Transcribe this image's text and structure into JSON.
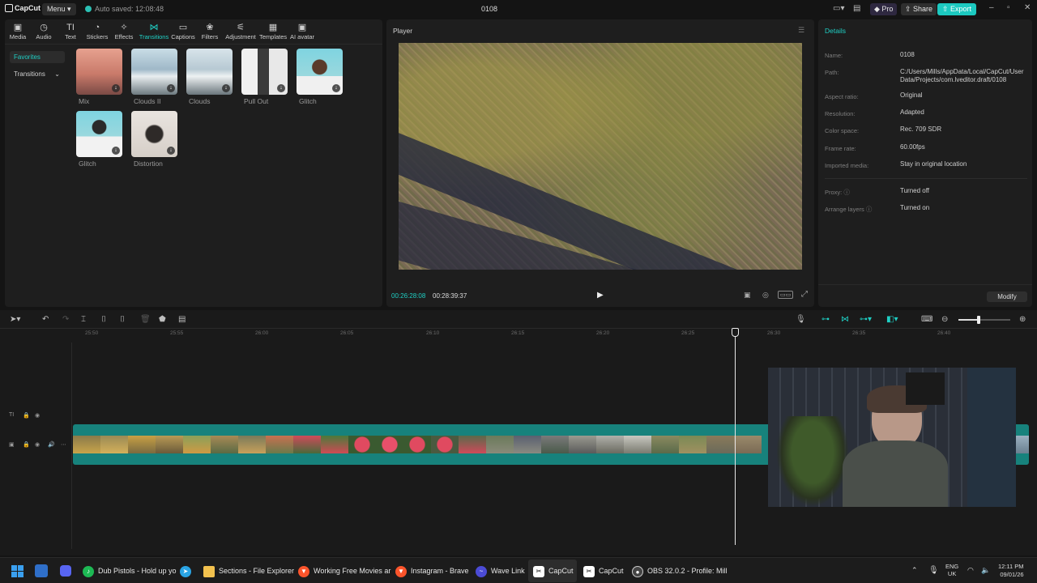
{
  "titlebar": {
    "logo": "CapCut",
    "menu_label": "Menu",
    "autosave": "Auto saved: 12:08:48",
    "doc_title": "0108",
    "pro_label": "Pro",
    "share_label": "Share",
    "export_label": "Export"
  },
  "tabs": [
    {
      "label": "Media",
      "icon": "media-icon"
    },
    {
      "label": "Audio",
      "icon": "audio-icon"
    },
    {
      "label": "Text",
      "icon": "text-icon"
    },
    {
      "label": "Stickers",
      "icon": "stickers-icon"
    },
    {
      "label": "Effects",
      "icon": "effects-icon"
    },
    {
      "label": "Transitions",
      "icon": "transitions-icon",
      "active": true
    },
    {
      "label": "Captions",
      "icon": "captions-icon"
    },
    {
      "label": "Filters",
      "icon": "filters-icon"
    },
    {
      "label": "Adjustment",
      "icon": "adjustment-icon"
    },
    {
      "label": "Templates",
      "icon": "templates-icon"
    },
    {
      "label": "AI avatar",
      "icon": "ai-avatar-icon"
    }
  ],
  "sidebar": {
    "favorites": "Favorites",
    "transitions": "Transitions"
  },
  "transitions": [
    {
      "label": "Mix"
    },
    {
      "label": "Clouds II"
    },
    {
      "label": "Clouds"
    },
    {
      "label": "Pull Out"
    },
    {
      "label": "Glitch"
    },
    {
      "label": "Glitch"
    },
    {
      "label": "Distortion"
    }
  ],
  "player": {
    "title": "Player",
    "current_time": "00:26:28:08",
    "total_time": "00:28:39:37"
  },
  "details": {
    "title": "Details",
    "rows": [
      {
        "label": "Name:",
        "value": "0108"
      },
      {
        "label": "Path:",
        "value": "C:/Users/Mills/AppData/Local/CapCut/User Data/Projects/com.lveditor.draft/0108"
      },
      {
        "label": "Aspect ratio:",
        "value": "Original"
      },
      {
        "label": "Resolution:",
        "value": "Adapted"
      },
      {
        "label": "Color space:",
        "value": "Rec. 709 SDR"
      },
      {
        "label": "Frame rate:",
        "value": "60.00fps"
      },
      {
        "label": "Imported media:",
        "value": "Stay in original location"
      },
      {
        "label": "Proxy:",
        "value": "Turned off"
      },
      {
        "label": "Arrange layers",
        "value": "Turned on"
      }
    ],
    "modify_label": "Modify"
  },
  "timeline": {
    "ruler": [
      "25:50",
      "25:55",
      "26:00",
      "26:05",
      "26:10",
      "26:15",
      "26:20",
      "26:25",
      "26:30",
      "26:35",
      "26:40"
    ]
  },
  "taskbar": {
    "apps": [
      {
        "label": "Dub Pistols - Hold up yo",
        "color": "#1db954"
      },
      {
        "label": "",
        "color": "#2aa4e4"
      },
      {
        "label": "Sections - File Explorer",
        "color": "#f2c14e"
      },
      {
        "label": "Working Free Movies ar",
        "color": "#fb542b"
      },
      {
        "label": "Instagram - Brave",
        "color": "#fb542b"
      },
      {
        "label": "Wave Link",
        "color": "#4b4bd6"
      },
      {
        "label": "CapCut",
        "color": "#ffffff"
      },
      {
        "label": "CapCut",
        "color": "#ffffff"
      },
      {
        "label": "OBS 32.0.2 - Profile: Mill",
        "color": "#444444"
      }
    ],
    "lang": "ENG",
    "region": "UK",
    "time": "12:11 PM",
    "date": "09/01/26"
  }
}
